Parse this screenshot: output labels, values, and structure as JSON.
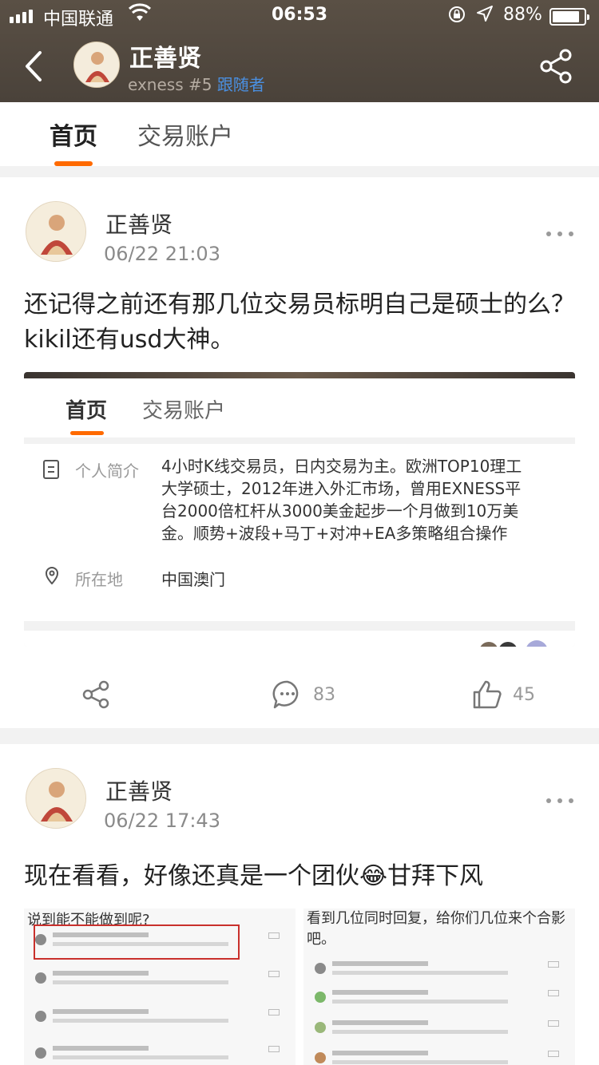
{
  "status_bar": {
    "carrier": "中国联通",
    "time": "06:53",
    "battery_percent": "88%",
    "battery_level": 0.88
  },
  "profile_header": {
    "name": "正善贤",
    "subtitle_gray": "exness #5",
    "subtitle_link": "跟随者",
    "icons": [
      "back-arrow-icon",
      "share-icon"
    ]
  },
  "tabs": [
    {
      "label": "首页",
      "active": true
    },
    {
      "label": "交易账户",
      "active": false
    }
  ],
  "posts": [
    {
      "author": "正善贤",
      "time": "06/22 21:03",
      "text": "还记得之前还有那几位交易员标明自己是硕士的么？kikil还有usd大神。",
      "embedded_screenshot": {
        "tab_active": "首页",
        "tab_inactive": "交易账户",
        "intro_label": "个人简介",
        "intro_text": "4小时K线交易员，日内交易为主。欧洲TOP10理工大学硕士，2012年进入外汇市场，曾用EXNESS平台2000倍杠杆从3000美金起步一个月做到10万美金。顺势+波段+马丁+对冲+EA多策略组合操作",
        "location_label": "所在地",
        "location_value": "中国澳门"
      },
      "comments": "83",
      "likes": "45"
    },
    {
      "author": "正善贤",
      "time": "06/22 17:43",
      "text_before": "现在看看，好像还真是一个团伙",
      "emoji": "😂",
      "text_after": "甘拜下风",
      "image_left_caption": "说到能不能做到呢?",
      "image_right_caption": "看到几位同时回复，给你们几位来个合影吧。"
    }
  ]
}
